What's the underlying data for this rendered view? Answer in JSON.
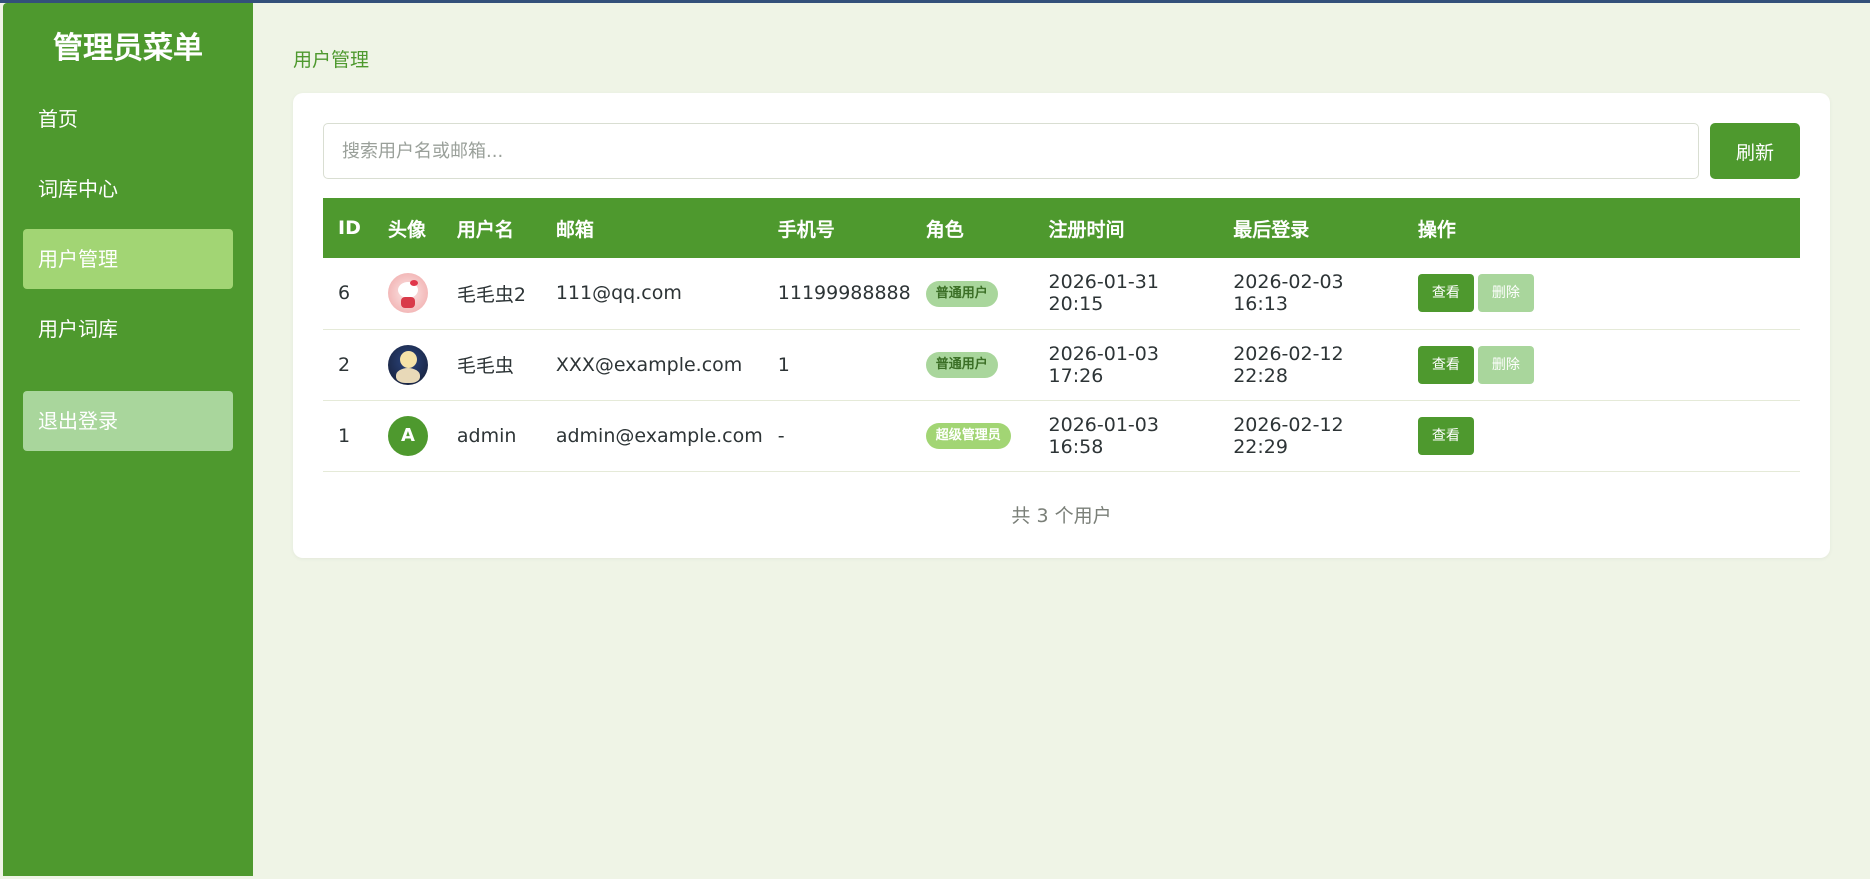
{
  "sidebar": {
    "title": "管理员菜单",
    "items": [
      {
        "label": "首页",
        "active": false
      },
      {
        "label": "词库中心",
        "active": false
      },
      {
        "label": "用户管理",
        "active": true
      },
      {
        "label": "用户词库",
        "active": false
      }
    ],
    "logout_label": "退出登录"
  },
  "breadcrumb": "用户管理",
  "search": {
    "placeholder": "搜索用户名或邮箱...",
    "value": "",
    "refresh_label": "刷新"
  },
  "table": {
    "headers": [
      "ID",
      "头像",
      "用户名",
      "邮箱",
      "手机号",
      "角色",
      "注册时间",
      "最后登录",
      "操作"
    ],
    "rows": [
      {
        "id": "6",
        "avatar": "hello-kitty-avatar",
        "username": "毛毛虫2",
        "email": "111@qq.com",
        "phone": "11199988888",
        "role": "普通用户",
        "registered": "2026-01-31 20:15",
        "last_login": "2026-02-03 16:13",
        "view_label": "查看",
        "delete_label": "删除"
      },
      {
        "id": "2",
        "avatar": "moon-scene-avatar",
        "username": "毛毛虫",
        "email": "XXX@example.com",
        "phone": "1",
        "role": "普通用户",
        "registered": "2026-01-03 17:26",
        "last_login": "2026-02-12 22:28",
        "view_label": "查看",
        "delete_label": "删除"
      },
      {
        "id": "1",
        "avatar": "A",
        "username": "admin",
        "email": "admin@example.com",
        "phone": "-",
        "role": "超级管理员",
        "registered": "2026-01-03 16:58",
        "last_login": "2026-02-12 22:29",
        "view_label": "查看"
      }
    ]
  },
  "footer": {
    "total_text": "共 3 个用户"
  },
  "colors": {
    "primary": "#4e992e",
    "active_nav": "#a2d574",
    "light_green": "#a9d69c",
    "background": "#eff4e6"
  }
}
